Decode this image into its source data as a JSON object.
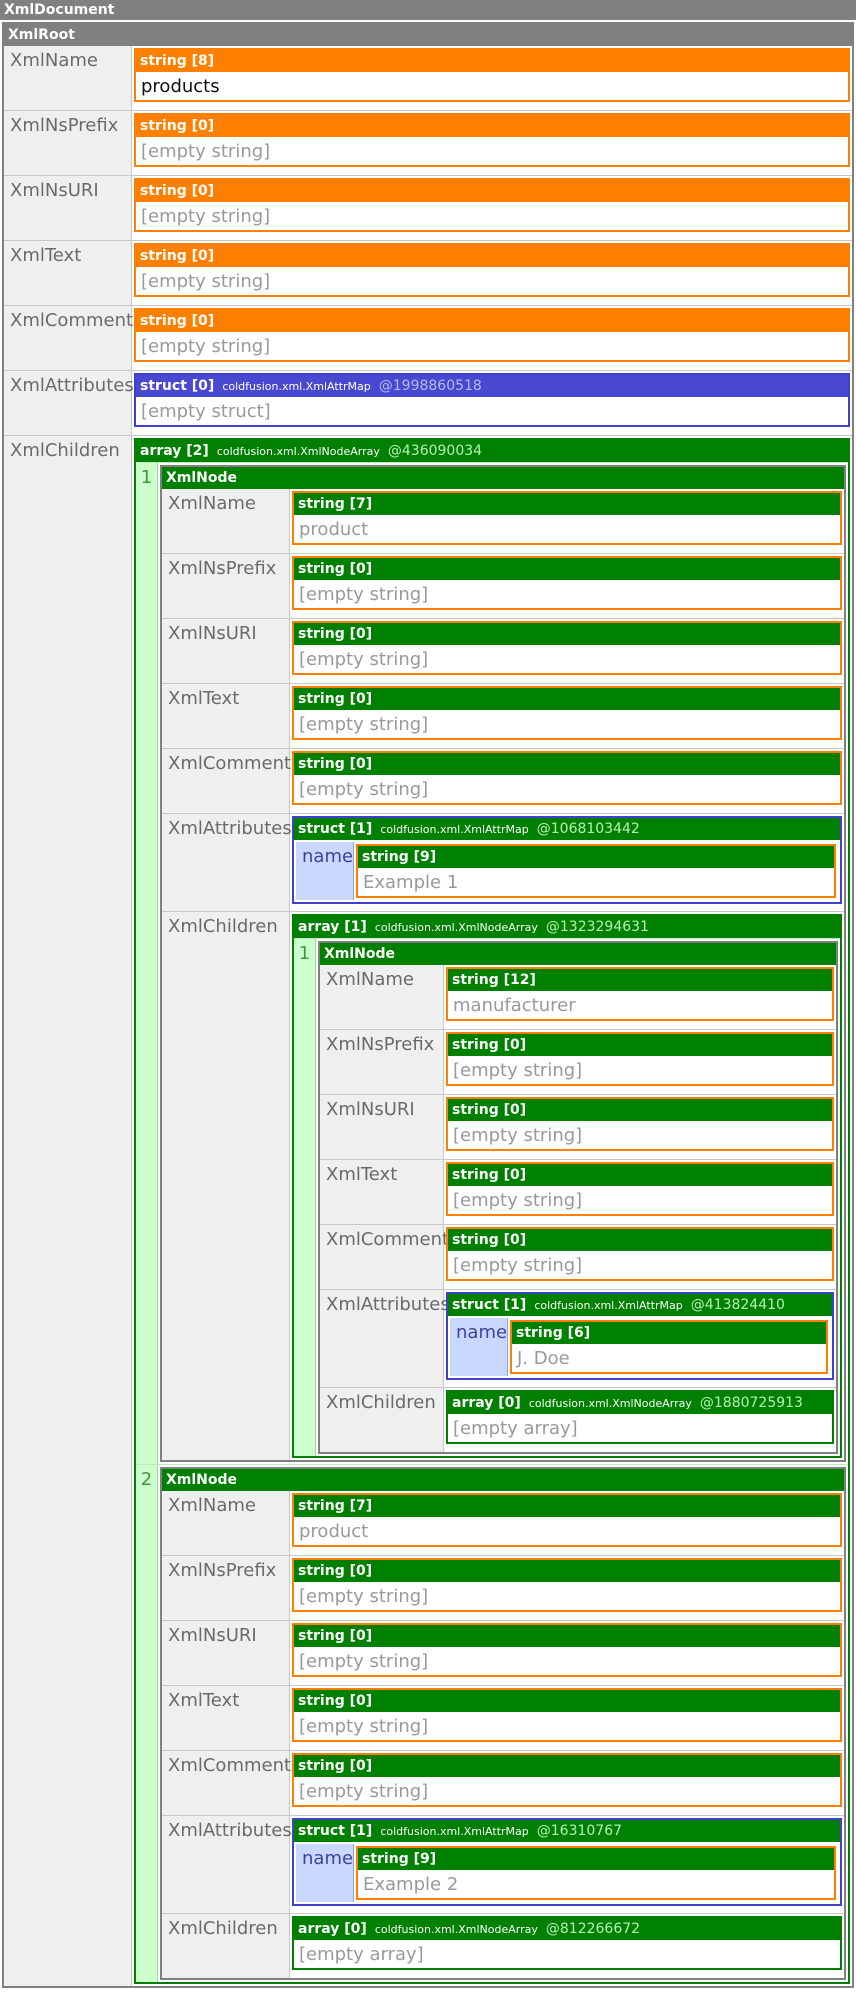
{
  "document": {
    "title": "XmlDocument",
    "root_title": "XmlRoot",
    "keys": {
      "name": "XmlName",
      "nsprefix": "XmlNsPrefix",
      "nsuri": "XmlNsURI",
      "text": "XmlText",
      "comment": "XmlComment",
      "attributes": "XmlAttributes",
      "children": "XmlChildren"
    },
    "node_title": "XmlNode",
    "empty_string": "[empty string]",
    "empty_struct": "[empty struct]",
    "empty_array": "[empty array]",
    "attr_key": "name",
    "class_attr": "coldfusion.xml.XmlAttrMap",
    "class_array": "coldfusion.xml.XmlNodeArray",
    "root": {
      "name_type": "string [8]",
      "name": "products",
      "str0": "string [0]",
      "attr_type": "struct [0]",
      "attr_hash": "@1998860518",
      "children_type": "array [2]",
      "children_hash": "@436090034"
    },
    "product1": {
      "index": "1",
      "name_type": "string [7]",
      "name": "product",
      "attr_type": "struct [1]",
      "attr_hash": "@1068103442",
      "attr_value_type": "string [9]",
      "attr_value": "Example 1",
      "children_type": "array [1]",
      "children_hash": "@1323294631"
    },
    "manufacturer": {
      "index": "1",
      "name_type": "string [12]",
      "name": "manufacturer",
      "attr_type": "struct [1]",
      "attr_hash": "@413824410",
      "attr_value_type": "string [6]",
      "attr_value": "J. Doe",
      "children_type": "array [0]",
      "children_hash": "@1880725913"
    },
    "product2": {
      "index": "2",
      "name_type": "string [7]",
      "name": "product",
      "attr_type": "struct [1]",
      "attr_hash": "@16310767",
      "attr_value_type": "string [9]",
      "attr_value": "Example 2",
      "children_type": "array [0]",
      "children_hash": "@812266672"
    }
  },
  "colors": {
    "string": "#ff8000",
    "struct": "#4848d0",
    "array": "#008000",
    "node": "#808080"
  }
}
